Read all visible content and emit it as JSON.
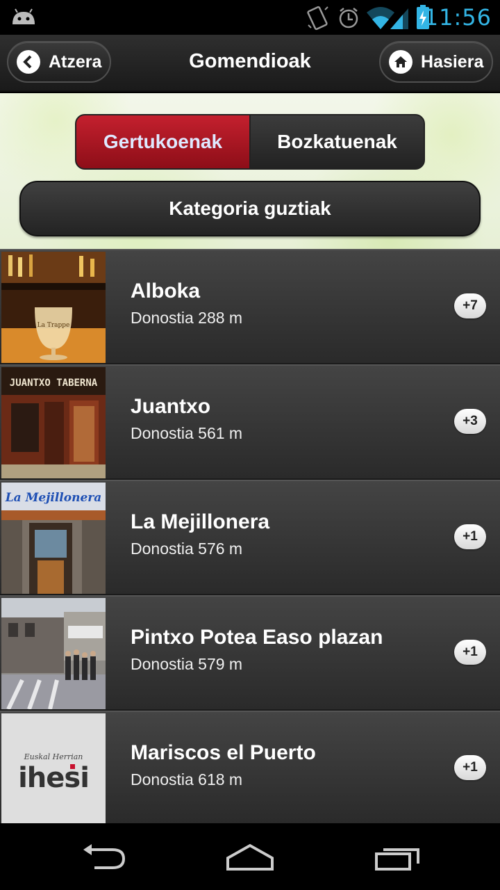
{
  "status_bar": {
    "time": "11:56"
  },
  "header": {
    "back_label": "Atzera",
    "title": "Gomendioak",
    "home_label": "Hasiera"
  },
  "filter": {
    "tabs": [
      {
        "label": "Gertukoenak",
        "active": true
      },
      {
        "label": "Bozkatuenak",
        "active": false
      }
    ],
    "category_button": "Kategoria guztiak"
  },
  "list": {
    "items": [
      {
        "name": "Alboka",
        "distance": "Donostia 288 m",
        "badge": "+7",
        "thumb": "Alboka bar photo"
      },
      {
        "name": "Juantxo",
        "distance": "Donostia 561 m",
        "badge": "+3",
        "thumb_text": "JUANTXO TABERNA"
      },
      {
        "name": "La Mejillonera",
        "distance": "Donostia 576 m",
        "badge": "+1",
        "thumb_text": "La Mejillonera"
      },
      {
        "name": "Pintxo Potea Easo plazan",
        "distance": "Donostia 579 m",
        "badge": "+1",
        "thumb": "street photo"
      },
      {
        "name": "Mariscos el Puerto",
        "distance": "Donostia 618 m",
        "badge": "+1",
        "thumb_small": "Euskal Herrian",
        "thumb_big": "ihesi"
      }
    ]
  },
  "colors": {
    "accent_red": "#b01622",
    "time_blue": "#33b5e5"
  },
  "icons": [
    "android-icon",
    "vibrate-icon",
    "alarm-icon",
    "wifi-icon",
    "signal-icon",
    "battery-icon",
    "chevron-left-icon",
    "home-icon",
    "back-nav-icon",
    "home-nav-icon",
    "recents-nav-icon"
  ]
}
